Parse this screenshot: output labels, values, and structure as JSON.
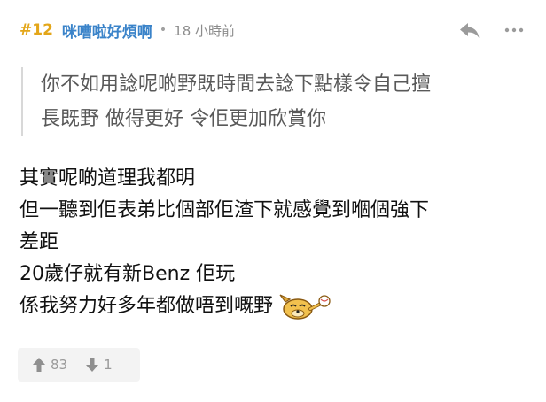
{
  "post": {
    "number": "#12",
    "username": "咪嘈啦好煩啊",
    "separator": "•",
    "time": "18 小時前",
    "icons": {
      "reply": "reply-arrow-icon",
      "more": "ellipsis-icon",
      "upvote": "arrow-up-icon",
      "downvote": "arrow-down-icon",
      "emoji": "dog-emoji-icon"
    }
  },
  "quote": {
    "lines": [
      "你不如用諗呢啲野既時間去諗下點樣令自己擅",
      "長既野 做得更好 令佢更加欣賞你"
    ]
  },
  "body": {
    "lines": [
      "其實呢啲道理我都明",
      "但一聽到佢表弟比個部佢渣下就感覺到嗰個強下",
      "差距",
      "20歲仔就有新Benz 佢玩",
      "係我努力好多年都做唔到嘅野"
    ]
  },
  "votes": {
    "up": "83",
    "down": "1"
  },
  "colors": {
    "post_number": "#e3a619",
    "username": "#3a83c9",
    "meta": "#8c8c8c",
    "quote_text": "#595959",
    "vote_bg": "#f3f3f3"
  }
}
